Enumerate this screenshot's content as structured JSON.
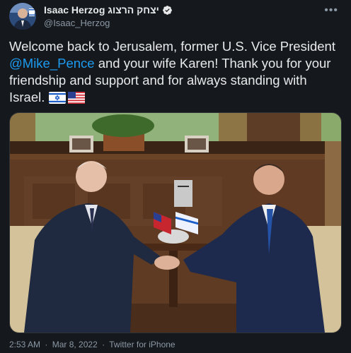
{
  "tweet": {
    "author": {
      "display_name": "Isaac Herzog יצחק הרצוג",
      "handle": "@Isaac_Herzog",
      "verified": true
    },
    "text": {
      "part1": "Welcome back to Jerusalem, former U.S. Vice President ",
      "mention": "@Mike_Pence",
      "part2": " and your wife Karen! Thank you for your friendship and support and for always standing with Israel. ",
      "flags": [
        "israel-flag",
        "usa-flag"
      ]
    },
    "media": {
      "description_icon": "photo"
    },
    "footer": {
      "time": "2:53 AM",
      "sep1": "·",
      "date": "Mar 8, 2022",
      "sep2": "·",
      "source": "Twitter for iPhone"
    },
    "colors": {
      "background": "#15181c",
      "link": "#1d9bf0",
      "secondary_text": "#8b98a5",
      "verified": "#e7e9ea"
    }
  }
}
